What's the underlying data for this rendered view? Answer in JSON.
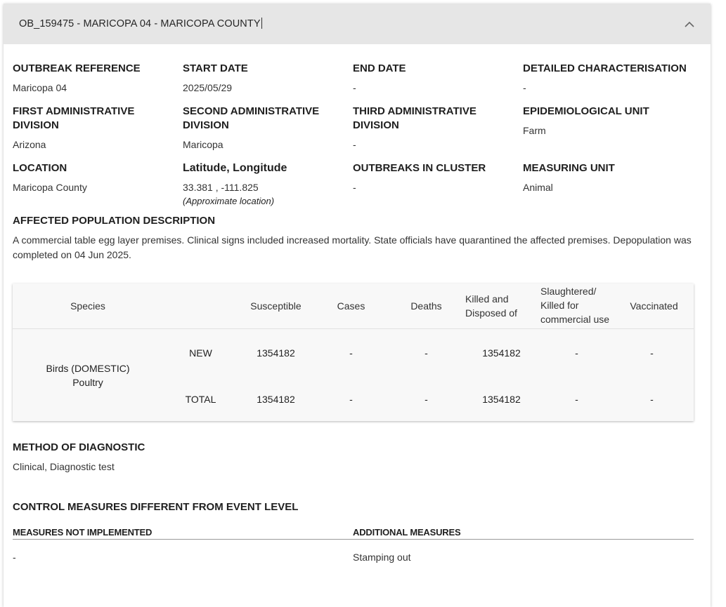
{
  "header": {
    "title": "OB_159475 - MARICOPA 04 - MARICOPA COUNTY"
  },
  "fields": [
    {
      "label": "OUTBREAK REFERENCE",
      "value": "Maricopa 04"
    },
    {
      "label": "START DATE",
      "value": "2025/05/29"
    },
    {
      "label": "END DATE",
      "value": "-"
    },
    {
      "label": "DETAILED CHARACTERISATION",
      "value": "-"
    },
    {
      "label": "FIRST ADMINISTRATIVE DIVISION",
      "value": "Arizona"
    },
    {
      "label": "SECOND ADMINISTRATIVE DIVISION",
      "value": "Maricopa"
    },
    {
      "label": "THIRD ADMINISTRATIVE DIVISION",
      "value": "-"
    },
    {
      "label": "EPIDEMIOLOGICAL UNIT",
      "value": "Farm"
    },
    {
      "label": "LOCATION",
      "value": "Maricopa County"
    },
    {
      "label": "Latitude, Longitude",
      "value": "33.381 , -111.825",
      "note": "(Approximate location)"
    },
    {
      "label": "OUTBREAKS IN CLUSTER",
      "value": "-"
    },
    {
      "label": "MEASURING UNIT",
      "value": "Animal"
    }
  ],
  "affected": {
    "label": "AFFECTED POPULATION DESCRIPTION",
    "text": "A commercial table egg layer premises. Clinical signs included increased mortality. State officials have quarantined the affected premises. Depopulation was completed on 04 Jun 2025."
  },
  "table": {
    "headers": {
      "species": "Species",
      "susceptible": "Susceptible",
      "cases": "Cases",
      "deaths": "Deaths",
      "killed": "Killed and Disposed of",
      "slaughtered": "Slaughtered/ Killed for commercial use",
      "vaccinated": "Vaccinated"
    },
    "species": "Birds (DOMESTIC) Poultry",
    "rows": [
      {
        "type": "NEW",
        "susceptible": "1354182",
        "cases": "-",
        "deaths": "-",
        "killed": "1354182",
        "slaughtered": "-",
        "vaccinated": "-"
      },
      {
        "type": "TOTAL",
        "susceptible": "1354182",
        "cases": "-",
        "deaths": "-",
        "killed": "1354182",
        "slaughtered": "-",
        "vaccinated": "-"
      }
    ]
  },
  "diagnostic": {
    "label": "METHOD OF DIAGNOSTIC",
    "value": "Clinical, Diagnostic test"
  },
  "control": {
    "label": "CONTROL MEASURES DIFFERENT FROM EVENT LEVEL",
    "not_implemented_label": "MEASURES NOT IMPLEMENTED",
    "additional_label": "ADDITIONAL MEASURES",
    "not_implemented_value": "-",
    "additional_value": "Stamping out"
  }
}
